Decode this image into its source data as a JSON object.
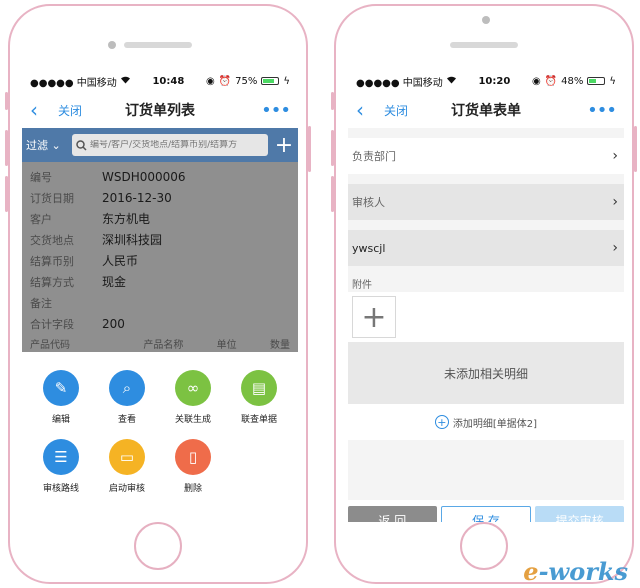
{
  "left_phone": {
    "status": {
      "carrier": "●●●●● 中国移动",
      "wifi": "wifi-icon",
      "time": "10:48",
      "battery": "75%",
      "battery_level": 0.75
    },
    "nav": {
      "back_icon": "chevron-left-icon",
      "close": "关闭",
      "title": "订货单列表",
      "more": "•••"
    },
    "filter": {
      "label": "过滤",
      "search_placeholder": "编号/客户/交货地点/结算币别/结算方",
      "plus": "+"
    },
    "details": [
      {
        "label": "编号",
        "value": "WSDH000006"
      },
      {
        "label": "订货日期",
        "value": "2016-12-30"
      },
      {
        "label": "客户",
        "value": "东方机电"
      },
      {
        "label": "交货地点",
        "value": "深圳科技园"
      },
      {
        "label": "结算币别",
        "value": "人民币"
      },
      {
        "label": "结算方式",
        "value": "现金"
      },
      {
        "label": "备注",
        "value": ""
      },
      {
        "label": "合计字段",
        "value": "200"
      }
    ],
    "detail_header": [
      "产品代码",
      "产品名称",
      "单位",
      "数量"
    ],
    "actions": [
      {
        "label": "编辑",
        "icon": "pencil-icon",
        "color": "#2e8de0"
      },
      {
        "label": "查看",
        "icon": "magnifier-icon",
        "color": "#2e8de0"
      },
      {
        "label": "关联生成",
        "icon": "link-icon",
        "color": "#7cc242"
      },
      {
        "label": "联查单据",
        "icon": "document-icon",
        "color": "#7cc242"
      },
      {
        "label": "审核路线",
        "icon": "list-icon",
        "color": "#2e8de0"
      },
      {
        "label": "启动审核",
        "icon": "folder-icon",
        "color": "#f5b324"
      },
      {
        "label": "删除",
        "icon": "trash-icon",
        "color": "#ef6c4a"
      }
    ]
  },
  "right_phone": {
    "status": {
      "carrier": "●●●●● 中国移动",
      "wifi": "wifi-icon",
      "time": "10:20",
      "battery": "48%",
      "battery_level": 0.48
    },
    "nav": {
      "back_icon": "chevron-left-icon",
      "close": "关闭",
      "title": "订货单表单",
      "more": "•••"
    },
    "fields": [
      {
        "label": "负责部门",
        "value": ""
      },
      {
        "label": "审核人",
        "value": ""
      },
      {
        "label": "ywscjl",
        "value": ""
      }
    ],
    "attachment_label": "附件",
    "attachment_add": "+",
    "empty_detail": "未添加相关明细",
    "add_detail": "添加明细[单据体2]",
    "buttons": {
      "back": "返 回",
      "save": "保 存",
      "submit": "提交审核"
    }
  },
  "watermark": {
    "prefix": "e",
    "rest": "-works"
  }
}
